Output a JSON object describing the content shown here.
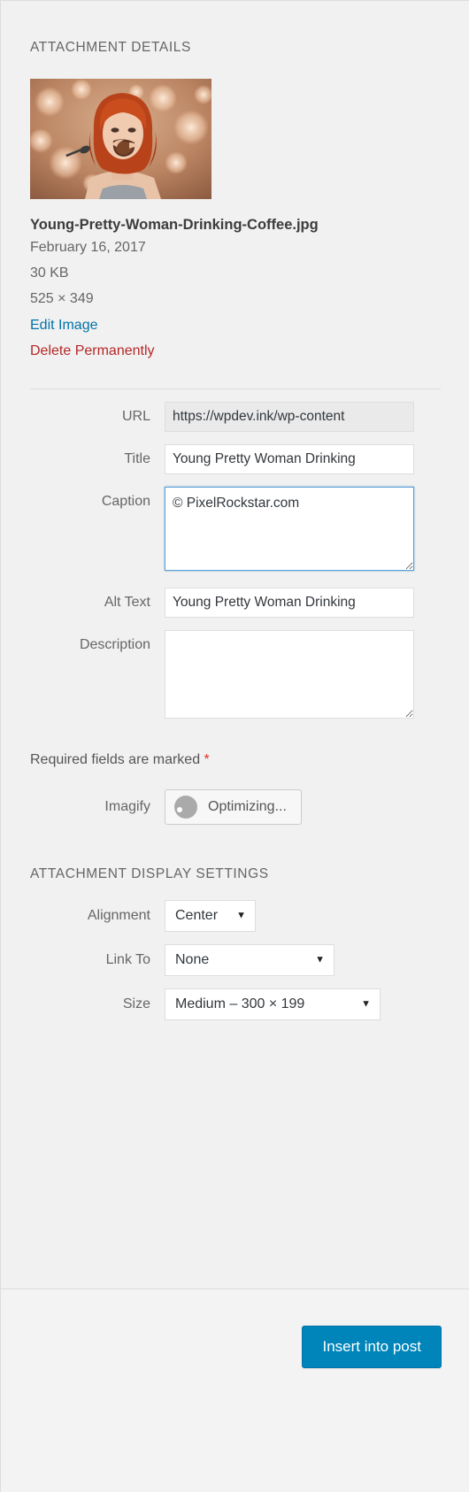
{
  "panel": {
    "section_title": "ATTACHMENT DETAILS",
    "display_section_title": "ATTACHMENT DISPLAY SETTINGS"
  },
  "attachment": {
    "thumbnail_alt": "Young woman with red hair drinking coffee against bokeh lights",
    "filename": "Young-Pretty-Woman-Drinking-Coffee.jpg",
    "date": "February 16, 2017",
    "filesize": "30 KB",
    "dimensions": "525 × 349",
    "edit_image_label": "Edit Image",
    "delete_permanently_label": "Delete Permanently"
  },
  "fields": {
    "url": {
      "label": "URL",
      "value": "https://wpdev.ink/wp-content"
    },
    "title": {
      "label": "Title",
      "value": "Young Pretty Woman Drinking"
    },
    "caption": {
      "label": "Caption",
      "value": "© PixelRockstar.com"
    },
    "alt_text": {
      "label": "Alt Text",
      "value": "Young Pretty Woman Drinking"
    },
    "description": {
      "label": "Description",
      "value": ""
    }
  },
  "required_note": {
    "text": "Required fields are marked ",
    "star": "*"
  },
  "imagify": {
    "label": "Imagify",
    "status_label": "Optimizing...",
    "spinner_icon": "loading-spinner-icon"
  },
  "display_settings": {
    "alignment": {
      "label": "Alignment",
      "value": "Center",
      "caret": "▼"
    },
    "link_to": {
      "label": "Link To",
      "value": "None",
      "caret": "▼"
    },
    "size": {
      "label": "Size",
      "value": "Medium – 300 × 199",
      "caret": "▼"
    }
  },
  "footer": {
    "insert_button_label": "Insert into post"
  },
  "colors": {
    "link_blue": "#0073aa",
    "delete_red": "#b52727",
    "required_red": "#dc3232",
    "button_blue": "#0085ba",
    "focus_blue": "#5b9dd9",
    "panel_bg": "#f1f1f1"
  }
}
